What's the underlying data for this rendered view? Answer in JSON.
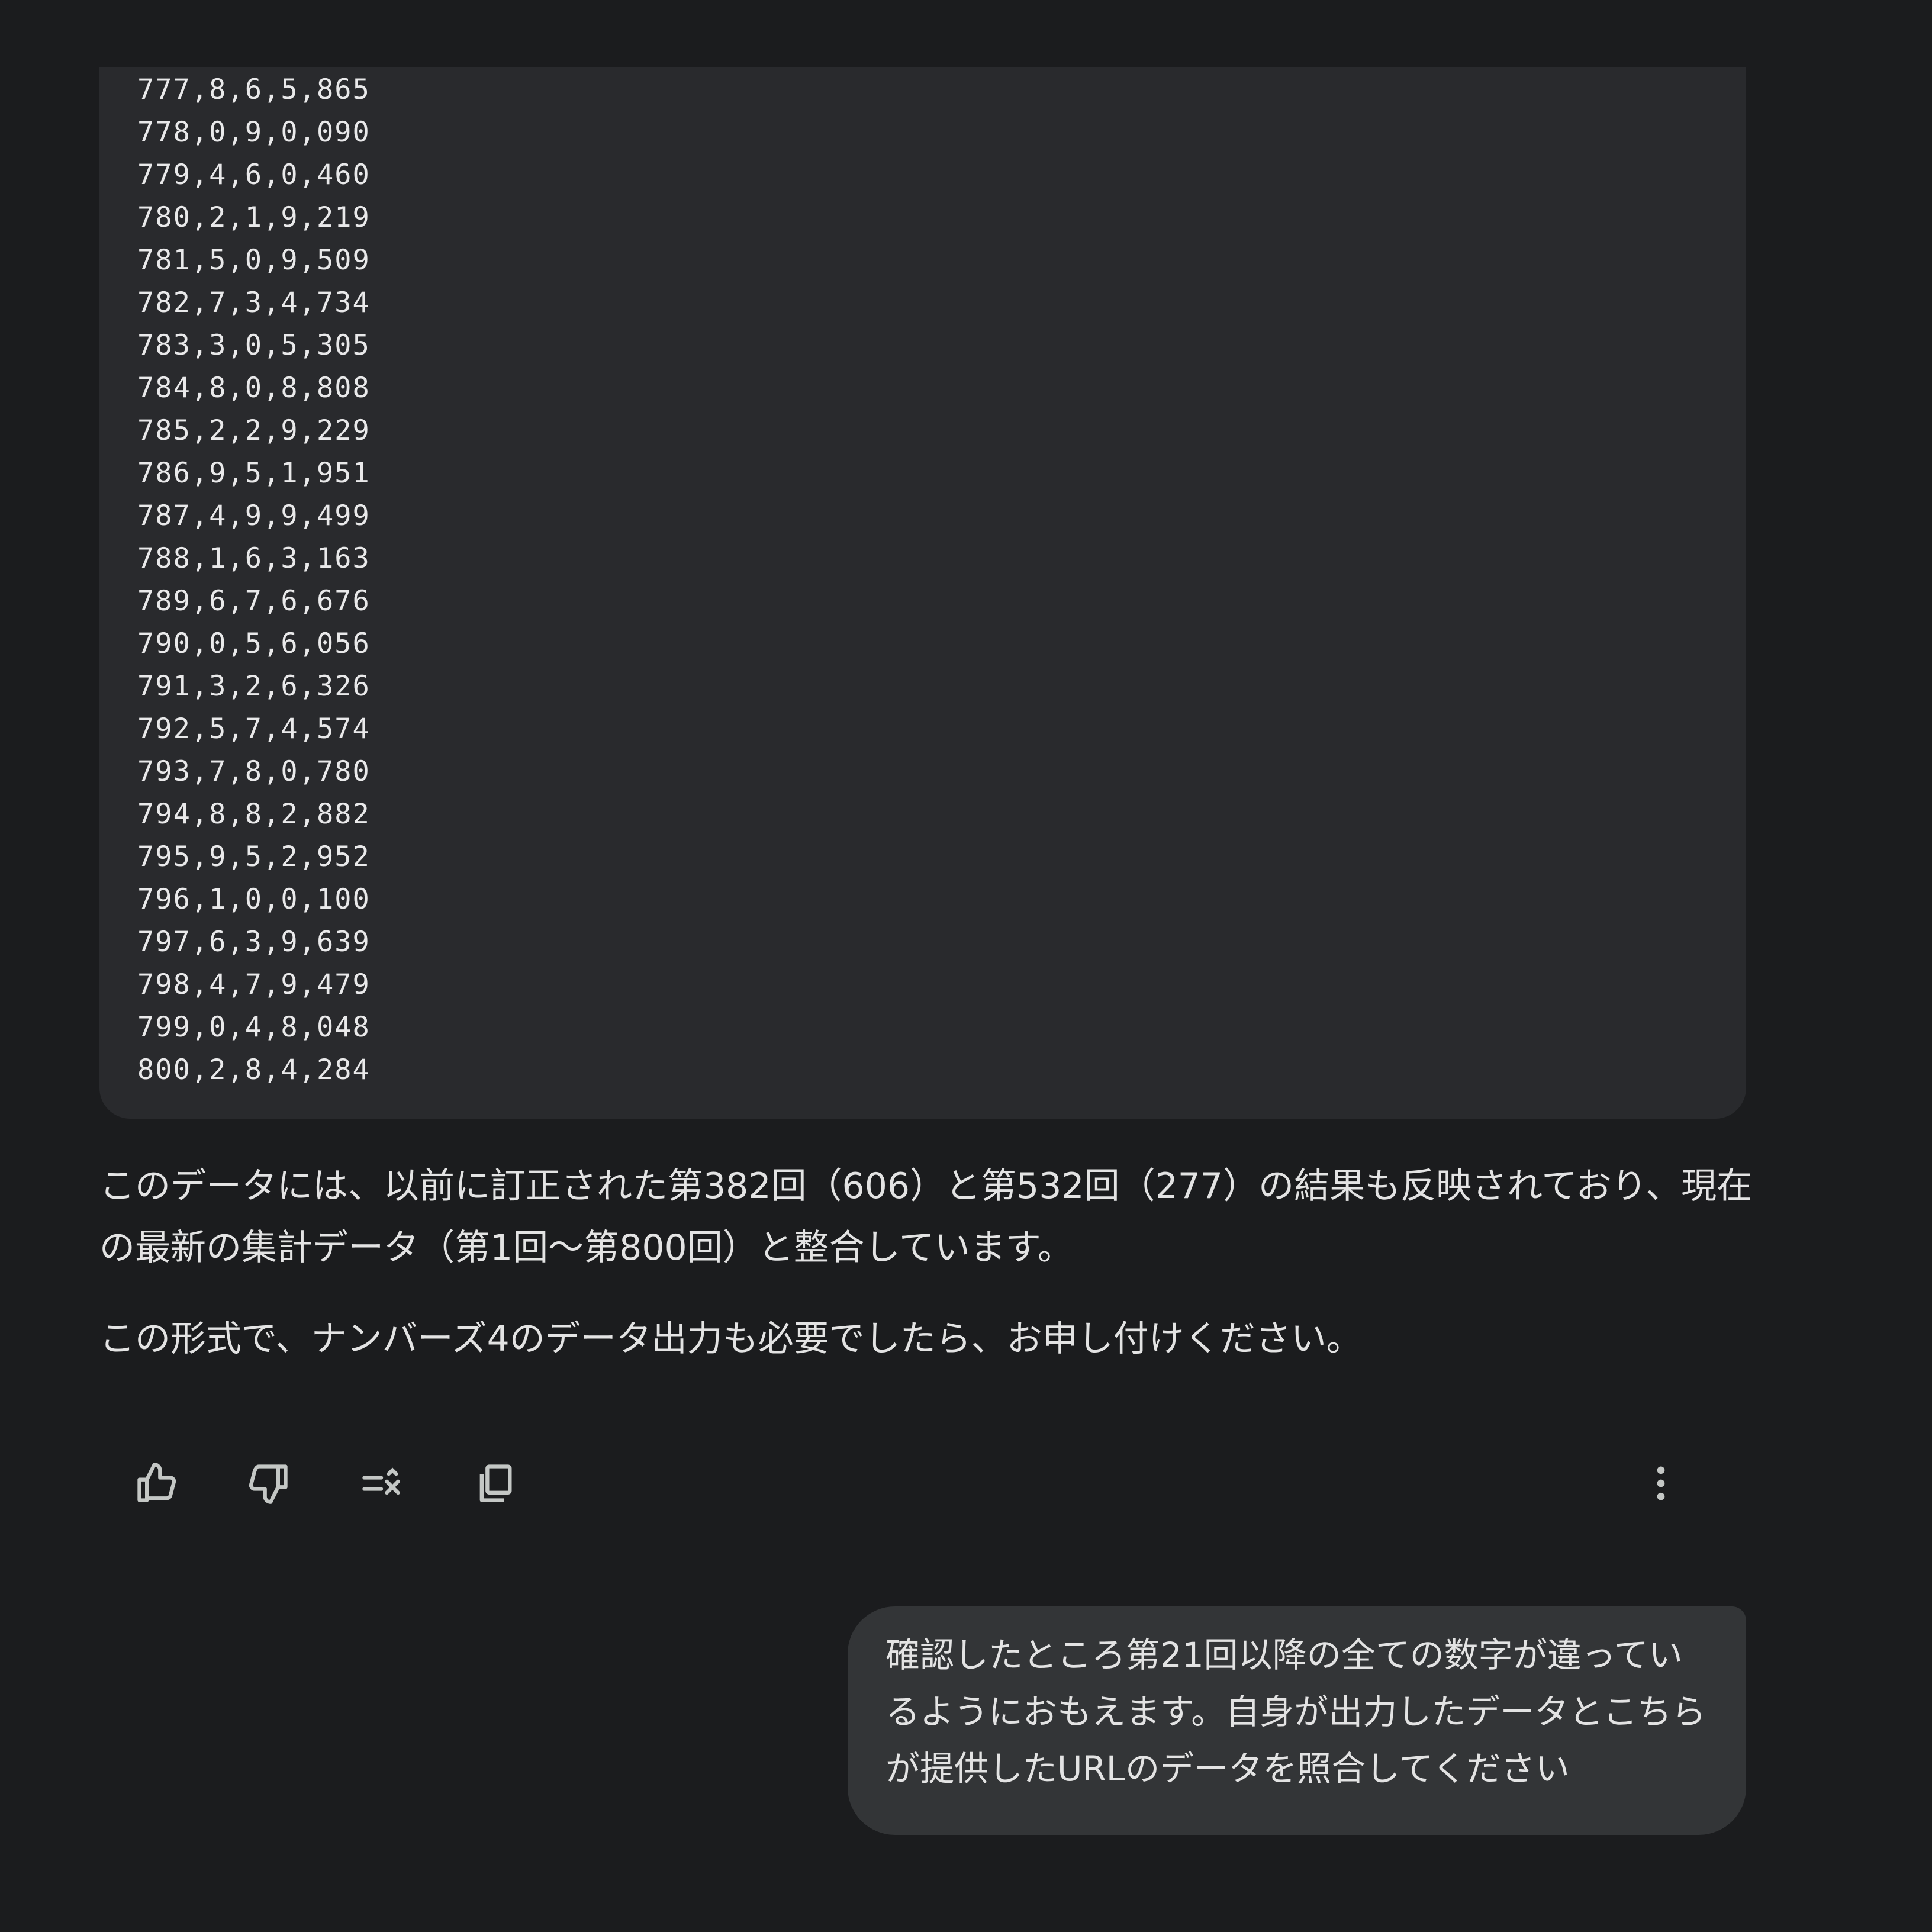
{
  "code_block": {
    "lines": [
      "777,8,6,5,865",
      "778,0,9,0,090",
      "779,4,6,0,460",
      "780,2,1,9,219",
      "781,5,0,9,509",
      "782,7,3,4,734",
      "783,3,0,5,305",
      "784,8,0,8,808",
      "785,2,2,9,229",
      "786,9,5,1,951",
      "787,4,9,9,499",
      "788,1,6,3,163",
      "789,6,7,6,676",
      "790,0,5,6,056",
      "791,3,2,6,326",
      "792,5,7,4,574",
      "793,7,8,0,780",
      "794,8,8,2,882",
      "795,9,5,2,952",
      "796,1,0,0,100",
      "797,6,3,9,639",
      "798,4,7,9,479",
      "799,0,4,8,048",
      "800,2,8,4,284"
    ]
  },
  "response": {
    "paragraph_1": "このデータには、以前に訂正された第382回（606）と第532回（277）の結果も反映されており、現在の最新の集計データ（第1回～第800回）と整合しています。",
    "paragraph_2": "この形式で、ナンバーズ4のデータ出力も必要でしたら、お申し付けください。"
  },
  "actions": {
    "icons": [
      "thumbs-up-icon",
      "thumbs-down-icon",
      "modify-response-icon",
      "copy-icon",
      "more-vert-icon"
    ]
  },
  "user_message": {
    "text": "確認したところ第21回以降の全ての数字が違っているようにおもえます。自身が出力したデータとこちらが提供したURLのデータを照合してください"
  },
  "colors": {
    "background": "#1b1c1e",
    "code_block_bg": "#292a2d",
    "user_bubble_bg": "#333537",
    "text": "#e3e3e3",
    "icon": "#c4c7c5"
  }
}
